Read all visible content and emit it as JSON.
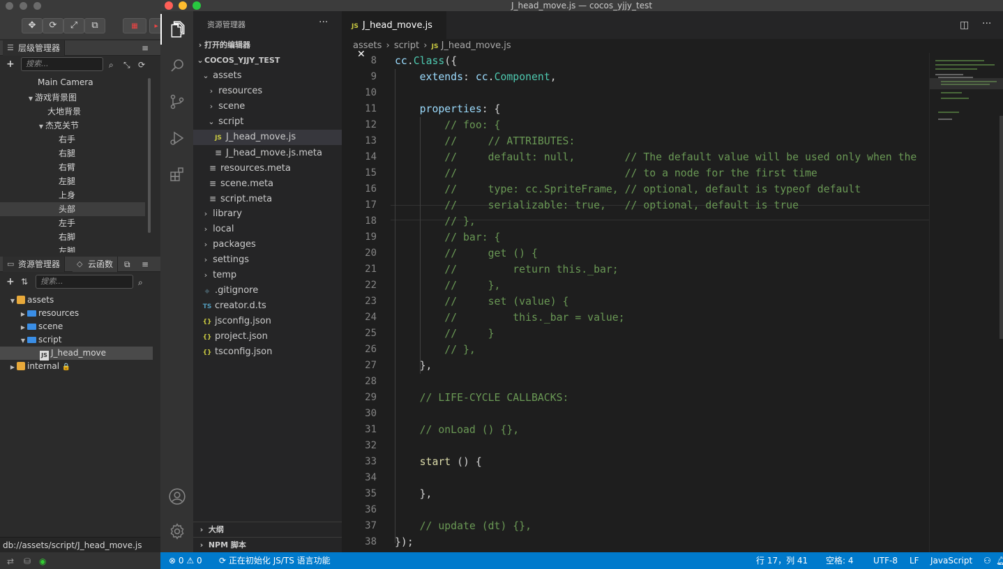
{
  "cocos": {
    "hierarchy": {
      "tab_label": "层级管理器",
      "search_placeholder": "搜索...",
      "items": [
        {
          "label": "Main Camera"
        },
        {
          "label": "游戏背景图"
        },
        {
          "label": "大地背景"
        },
        {
          "label": "杰克关节"
        },
        {
          "label": "右手"
        },
        {
          "label": "右腿"
        },
        {
          "label": "右臂"
        },
        {
          "label": "左腿"
        },
        {
          "label": "上身"
        },
        {
          "label": "头部"
        },
        {
          "label": "左手"
        },
        {
          "label": "右脚"
        },
        {
          "label": "左脚"
        }
      ]
    },
    "assets": {
      "tab_label": "资源管理器",
      "tab2_label": "云函数",
      "search_placeholder": "搜索...",
      "items": [
        {
          "label": "assets"
        },
        {
          "label": "resources"
        },
        {
          "label": "scene"
        },
        {
          "label": "script"
        },
        {
          "label": "J_head_move"
        },
        {
          "label": "internal"
        }
      ]
    },
    "status_path": "db://assets/script/J_head_move.js"
  },
  "vscode": {
    "window_title": "J_head_move.js — cocos_yjjy_test",
    "explorer": {
      "title": "资源管理器",
      "open_editors": "打开的编辑器",
      "project": "COCOS_YJJY_TEST",
      "tree": [
        {
          "label": "assets",
          "badge": ""
        },
        {
          "label": "resources",
          "badge": ""
        },
        {
          "label": "scene",
          "badge": ""
        },
        {
          "label": "script",
          "badge": ""
        },
        {
          "label": "J_head_move.js",
          "badge": "JS"
        },
        {
          "label": "J_head_move.js.meta",
          "badge": "≡"
        },
        {
          "label": "resources.meta",
          "badge": "≡"
        },
        {
          "label": "scene.meta",
          "badge": "≡"
        },
        {
          "label": "script.meta",
          "badge": "≡"
        },
        {
          "label": "library",
          "badge": ""
        },
        {
          "label": "local",
          "badge": ""
        },
        {
          "label": "packages",
          "badge": ""
        },
        {
          "label": "settings",
          "badge": ""
        },
        {
          "label": "temp",
          "badge": ""
        },
        {
          "label": ".gitignore",
          "badge": "◆"
        },
        {
          "label": "creator.d.ts",
          "badge": "TS"
        },
        {
          "label": "jsconfig.json",
          "badge": "{}"
        },
        {
          "label": "project.json",
          "badge": "{}"
        },
        {
          "label": "tsconfig.json",
          "badge": "{}"
        }
      ],
      "outline": "大纲",
      "npm": "NPM 脚本"
    },
    "tab": {
      "badge": "JS",
      "label": "J_head_move.js"
    },
    "breadcrumbs": [
      "assets",
      "script",
      "J_head_move.js"
    ],
    "code_lines": [
      {
        "n": "8",
        "t": "cc.Class({"
      },
      {
        "n": "9",
        "t": "    extends: cc.Component,"
      },
      {
        "n": "10",
        "t": ""
      },
      {
        "n": "11",
        "t": "    properties: {"
      },
      {
        "n": "12",
        "t": "        // foo: {"
      },
      {
        "n": "13",
        "t": "        //     // ATTRIBUTES:"
      },
      {
        "n": "14",
        "t": "        //     default: null,        // The default value will be used only when the"
      },
      {
        "n": "15",
        "t": "        //                           // to a node for the first time"
      },
      {
        "n": "16",
        "t": "        //     type: cc.SpriteFrame, // optional, default is typeof default"
      },
      {
        "n": "17",
        "t": "        //     serializable: true,   // optional, default is true"
      },
      {
        "n": "18",
        "t": "        // },"
      },
      {
        "n": "19",
        "t": "        // bar: {"
      },
      {
        "n": "20",
        "t": "        //     get () {"
      },
      {
        "n": "21",
        "t": "        //         return this._bar;"
      },
      {
        "n": "22",
        "t": "        //     },"
      },
      {
        "n": "23",
        "t": "        //     set (value) {"
      },
      {
        "n": "24",
        "t": "        //         this._bar = value;"
      },
      {
        "n": "25",
        "t": "        //     }"
      },
      {
        "n": "26",
        "t": "        // },"
      },
      {
        "n": "27",
        "t": "    },"
      },
      {
        "n": "28",
        "t": ""
      },
      {
        "n": "29",
        "t": "    // LIFE-CYCLE CALLBACKS:"
      },
      {
        "n": "30",
        "t": ""
      },
      {
        "n": "31",
        "t": "    // onLoad () {},"
      },
      {
        "n": "32",
        "t": ""
      },
      {
        "n": "33",
        "t": "    start () {"
      },
      {
        "n": "34",
        "t": ""
      },
      {
        "n": "35",
        "t": "    },"
      },
      {
        "n": "36",
        "t": ""
      },
      {
        "n": "37",
        "t": "    // update (dt) {},"
      },
      {
        "n": "38",
        "t": "});"
      }
    ],
    "status": {
      "errors": "0",
      "warnings": "0",
      "init_msg": "正在初始化 JS/TS 语言功能",
      "position": "行 17，列 41",
      "spaces": "空格: 4",
      "encoding": "UTF-8",
      "eol": "LF",
      "language": "JavaScript"
    }
  }
}
